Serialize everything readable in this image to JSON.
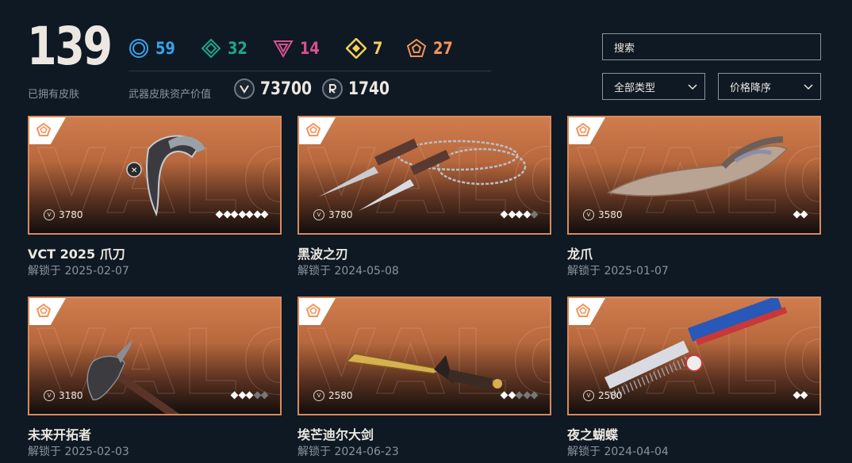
{
  "summary": {
    "total": "139",
    "total_caption": "已拥有皮肤",
    "asset_caption": "武器皮肤资产价值"
  },
  "tiers": [
    {
      "name": "select-tier",
      "icon": "circle-icon",
      "color": "#3aa0e8",
      "count": "59"
    },
    {
      "name": "deluxe-tier",
      "icon": "rhombus-icon",
      "color": "#1ea58c",
      "count": "32"
    },
    {
      "name": "premium-tier",
      "icon": "triangle-icon",
      "color": "#d6528f",
      "count": "14"
    },
    {
      "name": "ultra-tier",
      "icon": "diamond-icon",
      "color": "#f4cf5e",
      "count": "7"
    },
    {
      "name": "exclusive-tier",
      "icon": "pentagon-icon",
      "color": "#f4935a",
      "count": "27"
    }
  ],
  "currencies": [
    {
      "icon": "vp-icon",
      "amount": "73700"
    },
    {
      "icon": "radianite-icon",
      "amount": "1740"
    }
  ],
  "search": {
    "placeholder": "搜索"
  },
  "filters": {
    "type": "全部类型",
    "sort": "价格降序"
  },
  "cards": [
    {
      "name": "VCT 2025 爪刀",
      "date": "解锁于 2025-02-07",
      "price": "3780",
      "levels": 7,
      "levels_on": 7
    },
    {
      "name": "黑波之刃",
      "date": "解锁于 2024-05-08",
      "price": "3780",
      "levels": 5,
      "levels_on": 4
    },
    {
      "name": "龙爪",
      "date": "解锁于 2025-01-07",
      "price": "3580",
      "levels": 2,
      "levels_on": 2
    },
    {
      "name": "未来开拓者",
      "date": "解锁于 2025-02-03",
      "price": "3180",
      "levels": 5,
      "levels_on": 3
    },
    {
      "name": "埃芒迪尔大剑",
      "date": "解锁于 2024-06-23",
      "price": "2580",
      "levels": 5,
      "levels_on": 2
    },
    {
      "name": "夜之蝴蝶",
      "date": "解锁于 2024-04-04",
      "price": "2580",
      "levels": 2,
      "levels_on": 2
    }
  ],
  "card_bg_word": "VALORANT",
  "accent_color": "#d88a5b"
}
